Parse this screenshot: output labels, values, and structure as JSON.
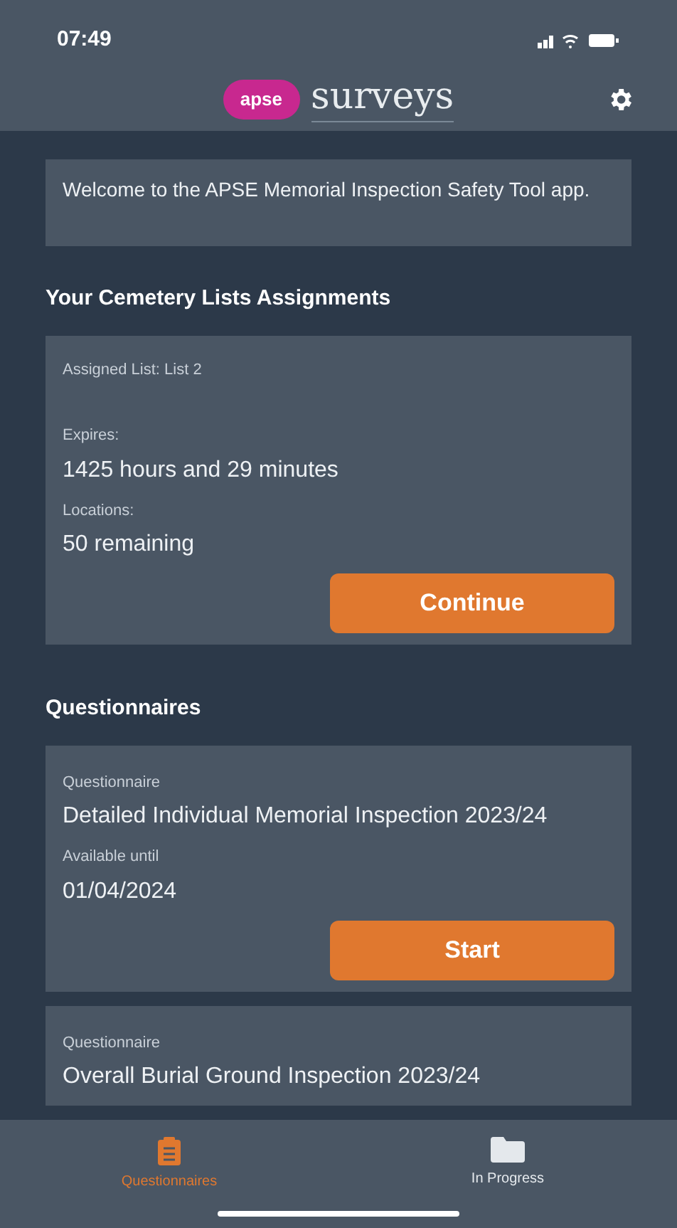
{
  "status_bar": {
    "time": "07:49"
  },
  "header": {
    "logo_badge": "apse",
    "logo_text": "surveys"
  },
  "welcome": "Welcome to the APSE Memorial Inspection Safety Tool app.",
  "assignments": {
    "heading": "Your Cemetery Lists Assignments",
    "cards": [
      {
        "title": "Assigned List: List 2",
        "fields": [
          {
            "label": "Expires:",
            "value": "1425 hours and 29 minutes"
          },
          {
            "label": "Locations:",
            "value": "50 remaining"
          }
        ],
        "button": "Continue"
      }
    ]
  },
  "questionnaires": {
    "heading": "Questionnaires",
    "cards": [
      {
        "fields": [
          {
            "label": "Questionnaire",
            "value": "Detailed Individual Memorial Inspection 2023/24"
          },
          {
            "label": "Available until",
            "value": "01/04/2024"
          }
        ],
        "button": "Start"
      },
      {
        "fields": [
          {
            "label": "Questionnaire",
            "value": "Overall Burial Ground Inspection 2023/24"
          }
        ]
      }
    ]
  },
  "tab_bar": [
    {
      "label": "Questionnaires",
      "kind": "clipboard",
      "selected": true
    },
    {
      "label": "In Progress",
      "kind": "folder",
      "selected": false
    }
  ]
}
